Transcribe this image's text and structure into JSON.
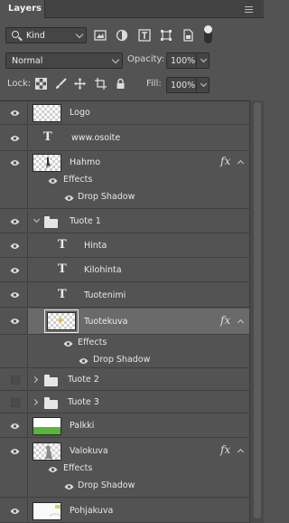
{
  "panel": {
    "tab_label": "Layers",
    "menu_icon": "panel-menu-icon"
  },
  "toolbar": {
    "kind_label": "Kind",
    "filter_icons": [
      "pixel-filter-icon",
      "adjustment-filter-icon",
      "type-filter-icon",
      "shape-filter-icon",
      "smart-object-filter-icon"
    ],
    "blend_mode": "Normal",
    "opacity_label": "Opacity:",
    "opacity_value": "100%",
    "lock_label": "Lock:",
    "lock_icons": [
      "lock-transparent-pixels-icon",
      "lock-image-pixels-icon",
      "lock-position-icon",
      "lock-artboard-icon",
      "lock-all-icon"
    ],
    "fill_label": "Fill:",
    "fill_value": "100%"
  },
  "layers": {
    "logo": "Logo",
    "www": "www.osoite",
    "hahmo": "Hahmo",
    "hahmo_effects": "Effects",
    "hahmo_drop_shadow": "Drop Shadow",
    "tuote1": "Tuote 1",
    "hinta": "Hinta",
    "kilohinta": "Kilohinta",
    "tuotenimi": "Tuotenimi",
    "tuotekuva": "Tuotekuva",
    "tuotekuva_effects": "Effects",
    "tuotekuva_drop_shadow": "Drop Shadow",
    "tuote2": "Tuote 2",
    "tuote3": "Tuote 3",
    "palkki": "Palkki",
    "valokuva": "Valokuva",
    "valokuva_effects": "Effects",
    "valokuva_drop_shadow": "Drop Shadow",
    "pohjakuva": "Pohjakuva",
    "fx_label": "fx",
    "type_glyph": "T"
  },
  "colors": {
    "panel_bg": "#535353",
    "selected_row": "#6a6a6a",
    "palkki_green": "#58b43b"
  }
}
